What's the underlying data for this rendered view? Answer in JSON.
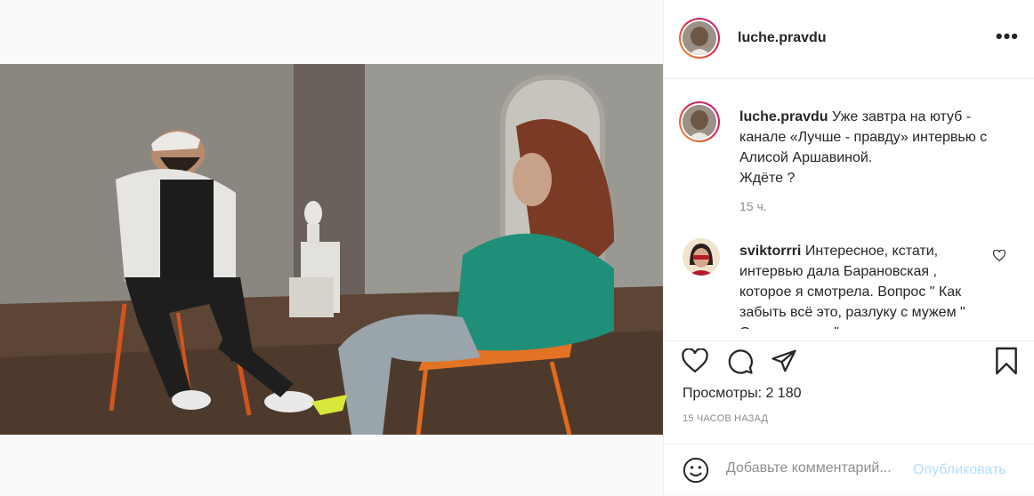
{
  "post": {
    "username": "luche.pravdu",
    "caption_user": "luche.pravdu",
    "caption_text": "Уже завтра на ютуб - канале «Лучше - правду» интервью с Алисой Аршавиной.",
    "caption_line2": "Ждёте ?",
    "caption_time": "15 ч.",
    "more_icon": "•••"
  },
  "comment": {
    "user": "sviktorrri",
    "text": "Интересное, кстати, интервью дала Барановская , которое я смотрела. Вопрос \" Как забыть всё это, разлуку с мужем \" Она ответила \""
  },
  "stats": {
    "views": "Просмотры: 2 180",
    "posted_ago": "15 ЧАСОВ НАЗАД"
  },
  "composer": {
    "placeholder": "Добавьте комментарий...",
    "publish": "Опубликовать"
  },
  "colors": {
    "link_disabled": "#b2dffc",
    "secondary": "#8e8e8e",
    "text": "#262626"
  }
}
